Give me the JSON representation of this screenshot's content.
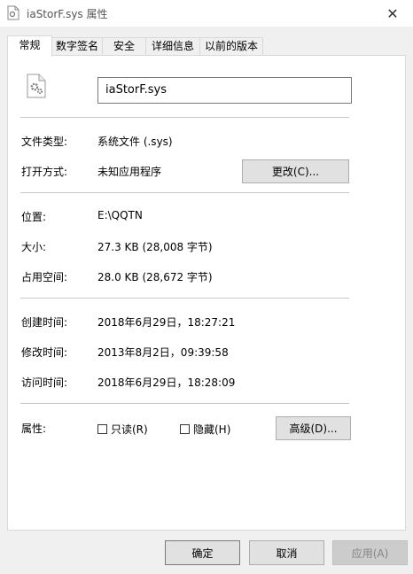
{
  "window": {
    "title": "iaStorF.sys 属性",
    "close_glyph": "✕"
  },
  "tabs": [
    {
      "label": "常规",
      "active": true
    },
    {
      "label": "数字签名",
      "active": false
    },
    {
      "label": "安全",
      "active": false
    },
    {
      "label": "详细信息",
      "active": false
    },
    {
      "label": "以前的版本",
      "active": false
    }
  ],
  "general": {
    "file_name": "iaStorF.sys",
    "file_type_label": "文件类型:",
    "file_type_value": "系统文件 (.sys)",
    "opens_with_label": "打开方式:",
    "opens_with_value": "未知应用程序",
    "change_button": "更改(C)...",
    "location_label": "位置:",
    "location_value": "E:\\QQTN",
    "size_label": "大小:",
    "size_value": "27.3 KB (28,008 字节)",
    "size_on_disk_label": "占用空间:",
    "size_on_disk_value": "28.0 KB (28,672 字节)",
    "created_label": "创建时间:",
    "created_value": "2018年6月29日，18:27:21",
    "modified_label": "修改时间:",
    "modified_value": "2013年8月2日，09:39:58",
    "accessed_label": "访问时间:",
    "accessed_value": "2018年6月29日，18:28:09",
    "attributes_label": "属性:",
    "readonly_label": "只读(R)",
    "readonly_checked": false,
    "hidden_label": "隐藏(H)",
    "hidden_checked": false,
    "advanced_button": "高级(D)..."
  },
  "footer": {
    "ok": "确定",
    "cancel": "取消",
    "apply": "应用(A)"
  },
  "colors": {
    "accent": "#0078d7",
    "panel_bg": "#ffffff",
    "window_bg": "#f0f0f0"
  }
}
